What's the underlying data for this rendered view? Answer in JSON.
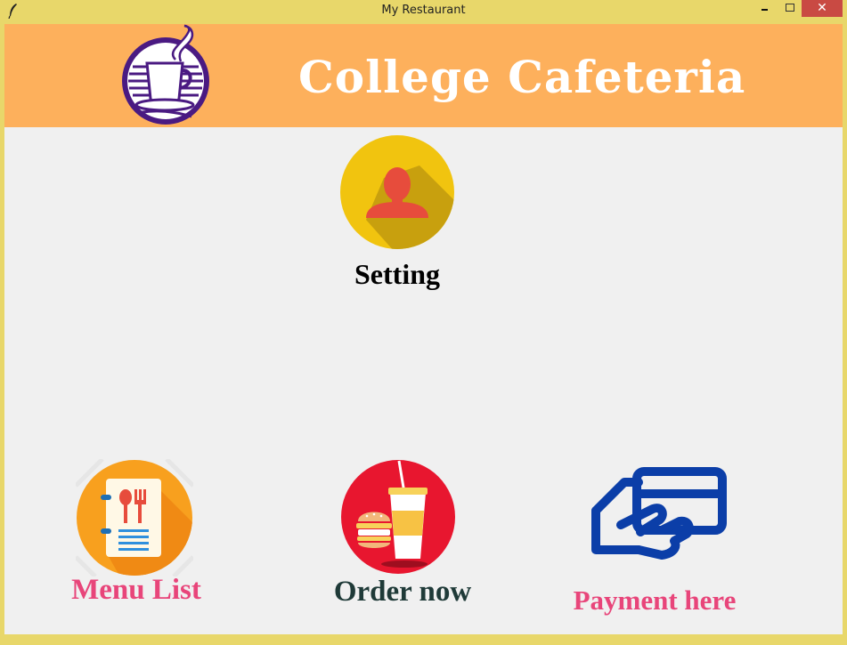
{
  "window": {
    "title": "My Restaurant",
    "minimize_icon": "minimize-icon",
    "maximize_icon": "maximize-icon",
    "close_glyph": "✕"
  },
  "header": {
    "brand": "College Cafeteria",
    "logo": "coffee-cup-logo",
    "background": "#fdb05c"
  },
  "tiles": {
    "setting": {
      "label": "Setting",
      "icon": "user-avatar-icon",
      "label_color": "#000000"
    },
    "menu": {
      "label": "Menu List",
      "icon": "menu-book-icon",
      "label_color": "#e8457a"
    },
    "order": {
      "label": "Order now",
      "icon": "fast-food-icon",
      "label_color": "#1f3a38"
    },
    "payment": {
      "label": "Payment here",
      "icon": "card-payment-icon",
      "label_color": "#e8457a"
    }
  },
  "colors": {
    "window_frame": "#e8d76a",
    "client_bg": "#f0f0f0",
    "close_button": "#c94a43"
  }
}
